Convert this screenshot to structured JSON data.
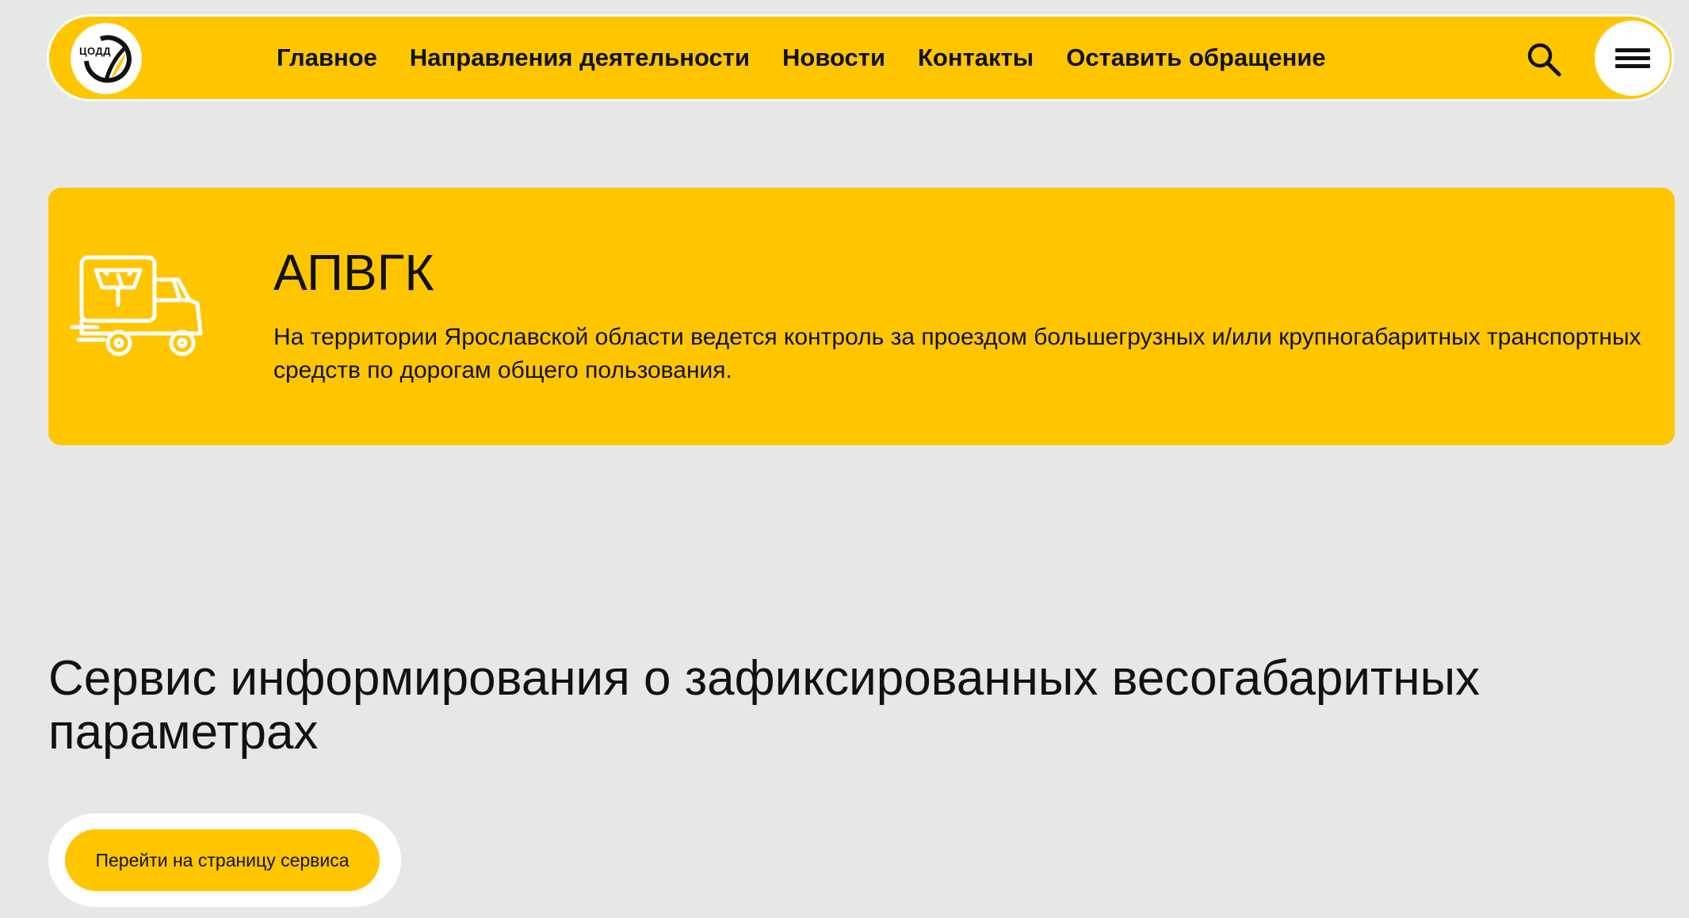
{
  "header": {
    "logo_text": "ЦОДД",
    "nav": [
      {
        "label": "Главное"
      },
      {
        "label": "Направления деятельности"
      },
      {
        "label": "Новости"
      },
      {
        "label": "Контакты"
      },
      {
        "label": "Оставить обращение"
      }
    ],
    "search_icon": "search-icon",
    "menu_icon": "hamburger-menu-icon"
  },
  "hero": {
    "icon": "truck-scale-icon",
    "title": "АПВГК",
    "text": "На территории Ярославской области ведется контроль за проездом большегрузных и/или крупногабаритных транспортных средств по дорогам общего пользования."
  },
  "service": {
    "title": "Сервис информирования о зафиксированных весогабаритных параметрах",
    "button_label": "Перейти на страницу сервиса"
  },
  "colors": {
    "accent": "#ffc600",
    "background": "#e7e7e5",
    "text": "#111111",
    "surface": "#ffffff"
  }
}
